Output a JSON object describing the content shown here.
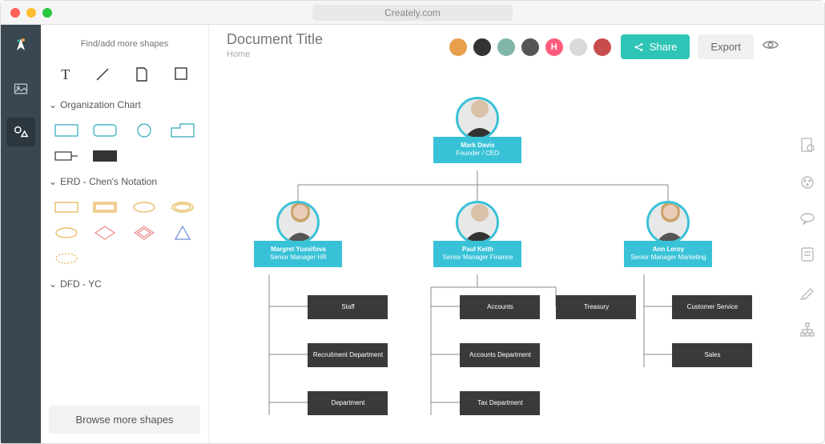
{
  "titlebar": {
    "url": "Creately.com"
  },
  "sidebar": {
    "search_placeholder": "Find/add more shapes",
    "sections": {
      "org": "Organization Chart",
      "erd": "ERD - Chen's Notation",
      "dfd": "DFD - YC"
    },
    "browse": "Browse more shapes"
  },
  "header": {
    "title": "Document Title",
    "breadcrumb": "Home",
    "share": "Share",
    "export": "Export",
    "avatars": [
      {
        "bg": "#e8a04c"
      },
      {
        "bg": "#333"
      },
      {
        "bg": "#7fb6a8"
      },
      {
        "bg": "#555"
      },
      {
        "bg": "#ff5c7c",
        "letter": "H"
      },
      {
        "bg": "#d9d9d9"
      },
      {
        "bg": "#c94c4c"
      }
    ]
  },
  "chart": {
    "ceo": {
      "name": "Mark Davis",
      "role": "Founder / CEO"
    },
    "mgr1": {
      "name": "Margret Yussifova",
      "role": "Senior Manager HR"
    },
    "mgr2": {
      "name": "Paul Keith",
      "role": "Senior Manager Finance"
    },
    "mgr3": {
      "name": "Ann Leroy",
      "role": "Senior Manager Marketing"
    },
    "depts": {
      "staff": "Staff",
      "recruit": "Recruitment Department",
      "dept": "Department",
      "accounts": "Accounts",
      "accdept": "Accounts Department",
      "tax": "Tax Department",
      "treasury": "Treasury",
      "cust": "Customer Service",
      "sales": "Sales"
    }
  }
}
